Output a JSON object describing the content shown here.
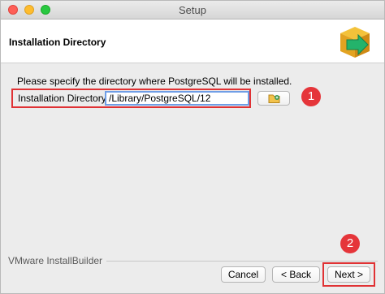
{
  "window": {
    "title": "Setup"
  },
  "header": {
    "title": "Installation Directory",
    "logo_icon": "bitrock-installer-box-arrow-icon"
  },
  "main": {
    "prompt": "Please specify the directory where PostgreSQL will be installed.",
    "directory_label": "Installation Directory",
    "directory_value": "/Library/PostgreSQL/12",
    "browse_icon": "folder-open-icon"
  },
  "annotations": {
    "step1": "1",
    "step2": "2",
    "highlight_color": "#e03234"
  },
  "footer": {
    "brand": "VMware InstallBuilder",
    "cancel_label": "Cancel",
    "back_label": "< Back",
    "next_label": "Next >"
  }
}
